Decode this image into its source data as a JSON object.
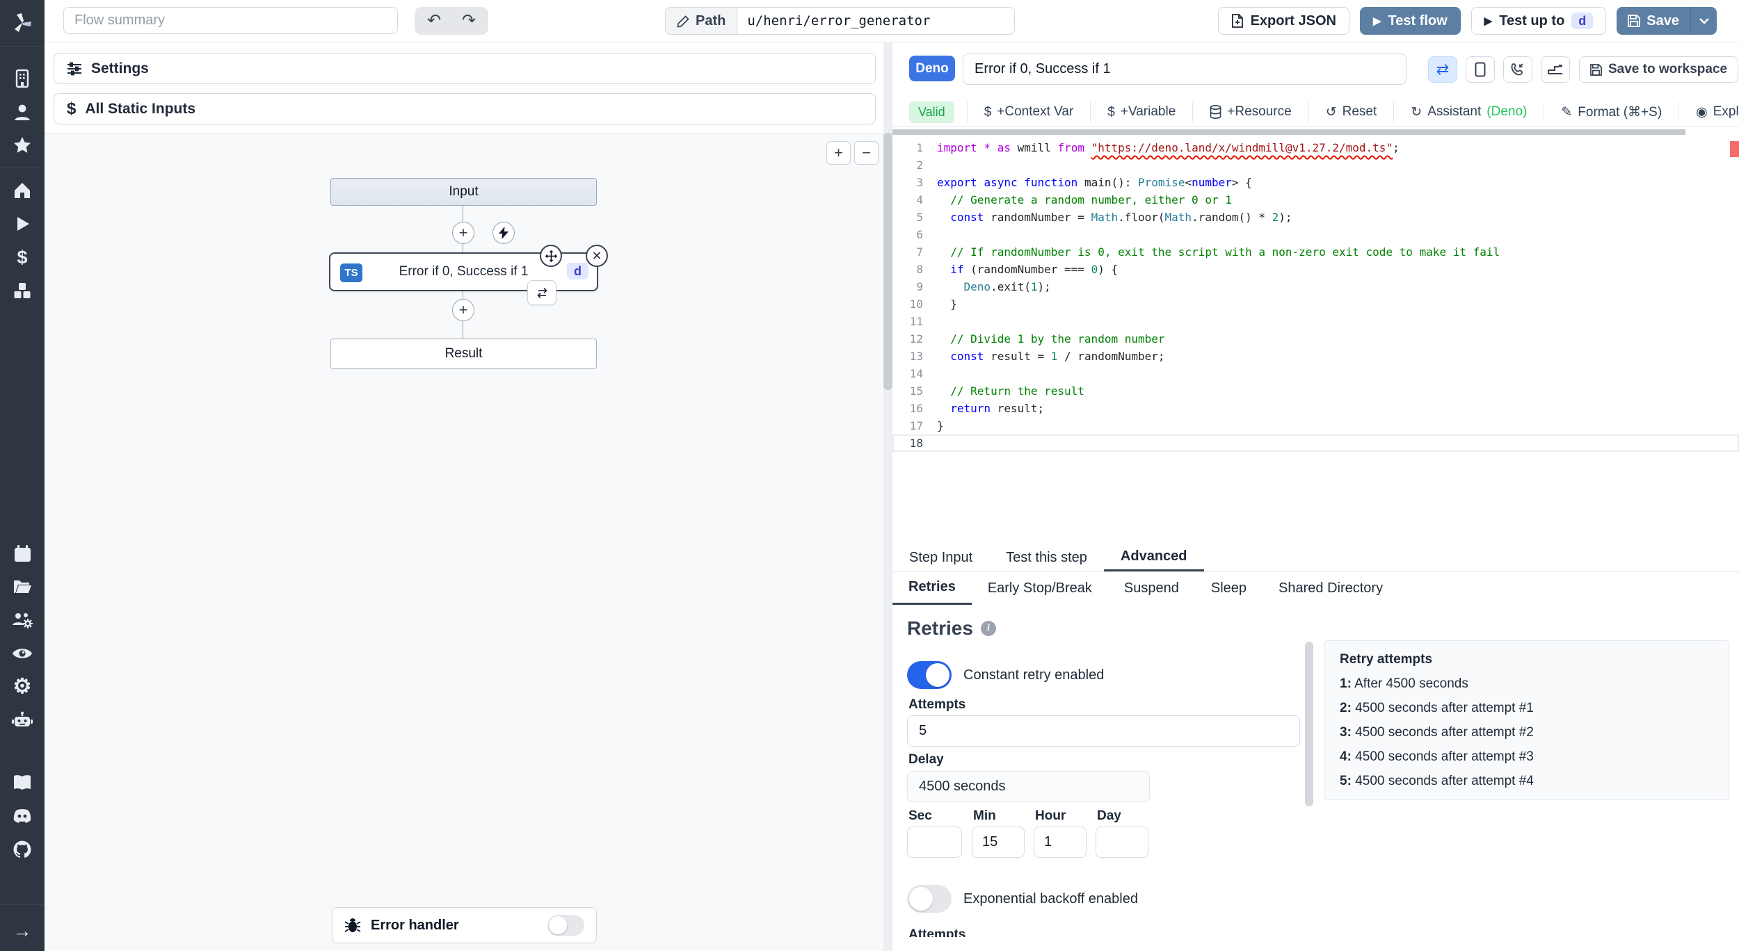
{
  "colors": {
    "accent_blue": "#5c7fa3",
    "deno_badge_blue": "#3b74e4",
    "valid_green_bg": "#d7f7e2",
    "valid_green_text": "#16a34a",
    "ts_badge_blue": "#3075c9",
    "d_chip_bg": "#e0e7ff",
    "d_chip_text": "#4338ca",
    "toggle_on_blue": "#2563eb",
    "sidebar_bg": "#2e3642",
    "error_marker": "#f56a6a"
  },
  "icons": {
    "undo": "↶",
    "redo": "↷",
    "play": "▶",
    "plus": "+",
    "minus": "−",
    "close": "×",
    "reset": "↺",
    "assistant_refresh": "↻",
    "format_pen": "✎",
    "explore": "◉",
    "dollar": "$",
    "arrow_right": "→",
    "info": "i",
    "sync": "⇄"
  },
  "sidebar": {
    "items": [
      "windmill-logo",
      "building",
      "user",
      "star",
      "home",
      "play",
      "dollar",
      "boxes",
      "calendar",
      "folder-open",
      "user-group",
      "eye",
      "settings-gear",
      "robot",
      "book",
      "discord",
      "github",
      "arrow-right"
    ]
  },
  "topbar": {
    "flow_summary_placeholder": "Flow summary",
    "path_label": "Path",
    "path_value": "u/henri/error_generator",
    "export_json": "Export JSON",
    "test_flow": "Test flow",
    "test_up_to": "Test up to",
    "test_up_to_badge": "d",
    "save": "Save"
  },
  "left_panel": {
    "settings": "Settings",
    "all_static_inputs": "All Static Inputs",
    "nodes": {
      "input": "Input",
      "step_lang_badge": "TS",
      "step_label": "Error if 0, Success if 1",
      "step_id_badge": "d",
      "result": "Result"
    },
    "error_handler": "Error handler"
  },
  "editor_header": {
    "lang_badge": "Deno",
    "step_name": "Error if 0, Success if 1",
    "save_to_workspace": "Save to workspace"
  },
  "editor_toolbar": {
    "valid": "Valid",
    "context_var": "+Context Var",
    "variable": "+Variable",
    "resource": "+Resource",
    "reset": "Reset",
    "assistant": "Assistant",
    "assistant_lang": "(Deno)",
    "format": "Format (⌘+S)",
    "explore": "Explore other s"
  },
  "code": {
    "lines": [
      {
        "n": 1,
        "t": [
          [
            "kw2",
            "import"
          ],
          [
            "pl",
            " "
          ],
          [
            "kw2",
            "*"
          ],
          [
            "pl",
            " "
          ],
          [
            "kw2",
            "as"
          ],
          [
            "pl",
            " wmill "
          ],
          [
            "kw2",
            "from"
          ],
          [
            "pl",
            " "
          ],
          [
            "strerr",
            "\"https://deno.land/x/windmill@v1.27.2/mod.ts\""
          ],
          [
            "pl",
            ";"
          ]
        ]
      },
      {
        "n": 2,
        "t": []
      },
      {
        "n": 3,
        "t": [
          [
            "kw",
            "export"
          ],
          [
            "pl",
            " "
          ],
          [
            "kw",
            "async"
          ],
          [
            "pl",
            " "
          ],
          [
            "kw",
            "function"
          ],
          [
            "pl",
            " main(): "
          ],
          [
            "type",
            "Promise"
          ],
          [
            "pl",
            "<"
          ],
          [
            "kw",
            "number"
          ],
          [
            "pl",
            "> {"
          ]
        ]
      },
      {
        "n": 4,
        "t": [
          [
            "pl",
            "  "
          ],
          [
            "cm",
            "// Generate a random number, either 0 or 1"
          ]
        ]
      },
      {
        "n": 5,
        "t": [
          [
            "pl",
            "  "
          ],
          [
            "kw",
            "const"
          ],
          [
            "pl",
            " randomNumber = "
          ],
          [
            "type",
            "Math"
          ],
          [
            "pl",
            ".floor("
          ],
          [
            "type",
            "Math"
          ],
          [
            "pl",
            ".random() * "
          ],
          [
            "num",
            "2"
          ],
          [
            "pl",
            ");"
          ]
        ]
      },
      {
        "n": 6,
        "t": []
      },
      {
        "n": 7,
        "t": [
          [
            "pl",
            "  "
          ],
          [
            "cm",
            "// If randomNumber is 0, exit the script with a non-zero exit code to make it fail"
          ]
        ]
      },
      {
        "n": 8,
        "t": [
          [
            "pl",
            "  "
          ],
          [
            "kw",
            "if"
          ],
          [
            "pl",
            " (randomNumber === "
          ],
          [
            "num",
            "0"
          ],
          [
            "pl",
            ") {"
          ]
        ]
      },
      {
        "n": 9,
        "t": [
          [
            "pl",
            "    "
          ],
          [
            "type",
            "Deno"
          ],
          [
            "pl",
            ".exit("
          ],
          [
            "num",
            "1"
          ],
          [
            "pl",
            ");"
          ]
        ]
      },
      {
        "n": 10,
        "t": [
          [
            "pl",
            "  }"
          ]
        ]
      },
      {
        "n": 11,
        "t": []
      },
      {
        "n": 12,
        "t": [
          [
            "pl",
            "  "
          ],
          [
            "cm",
            "// Divide 1 by the random number"
          ]
        ]
      },
      {
        "n": 13,
        "t": [
          [
            "pl",
            "  "
          ],
          [
            "kw",
            "const"
          ],
          [
            "pl",
            " result = "
          ],
          [
            "num",
            "1"
          ],
          [
            "pl",
            " / randomNumber;"
          ]
        ]
      },
      {
        "n": 14,
        "t": []
      },
      {
        "n": 15,
        "t": [
          [
            "pl",
            "  "
          ],
          [
            "cm",
            "// Return the result"
          ]
        ]
      },
      {
        "n": 16,
        "t": [
          [
            "pl",
            "  "
          ],
          [
            "kw",
            "return"
          ],
          [
            "pl",
            " result;"
          ]
        ]
      },
      {
        "n": 17,
        "t": [
          [
            "pl",
            "}"
          ]
        ]
      },
      {
        "n": 18,
        "t": [],
        "active": true
      }
    ]
  },
  "tabs": {
    "items": [
      "Step Input",
      "Test this step",
      "Advanced"
    ],
    "active": "Advanced"
  },
  "subtabs": {
    "items": [
      "Retries",
      "Early Stop/Break",
      "Suspend",
      "Sleep",
      "Shared Directory"
    ],
    "active": "Retries"
  },
  "retries": {
    "title": "Retries",
    "constant_toggle_label": "Constant retry enabled",
    "constant_toggle_on": true,
    "attempts_label": "Attempts",
    "attempts_value": "5",
    "delay_label": "Delay",
    "delay_value": "4500 seconds",
    "time_fields": [
      {
        "label": "Sec",
        "value": ""
      },
      {
        "label": "Min",
        "value": "15"
      },
      {
        "label": "Hour",
        "value": "1"
      },
      {
        "label": "Day",
        "value": ""
      }
    ],
    "exponential_toggle_label": "Exponential backoff enabled",
    "exponential_toggle_on": false,
    "clipped_next_label": "Attempts",
    "preview": {
      "title": "Retry attempts",
      "items": [
        {
          "n": "1:",
          "text": "After 4500 seconds"
        },
        {
          "n": "2:",
          "text": "4500 seconds after attempt #1"
        },
        {
          "n": "3:",
          "text": "4500 seconds after attempt #2"
        },
        {
          "n": "4:",
          "text": "4500 seconds after attempt #3"
        },
        {
          "n": "5:",
          "text": "4500 seconds after attempt #4"
        }
      ]
    }
  }
}
